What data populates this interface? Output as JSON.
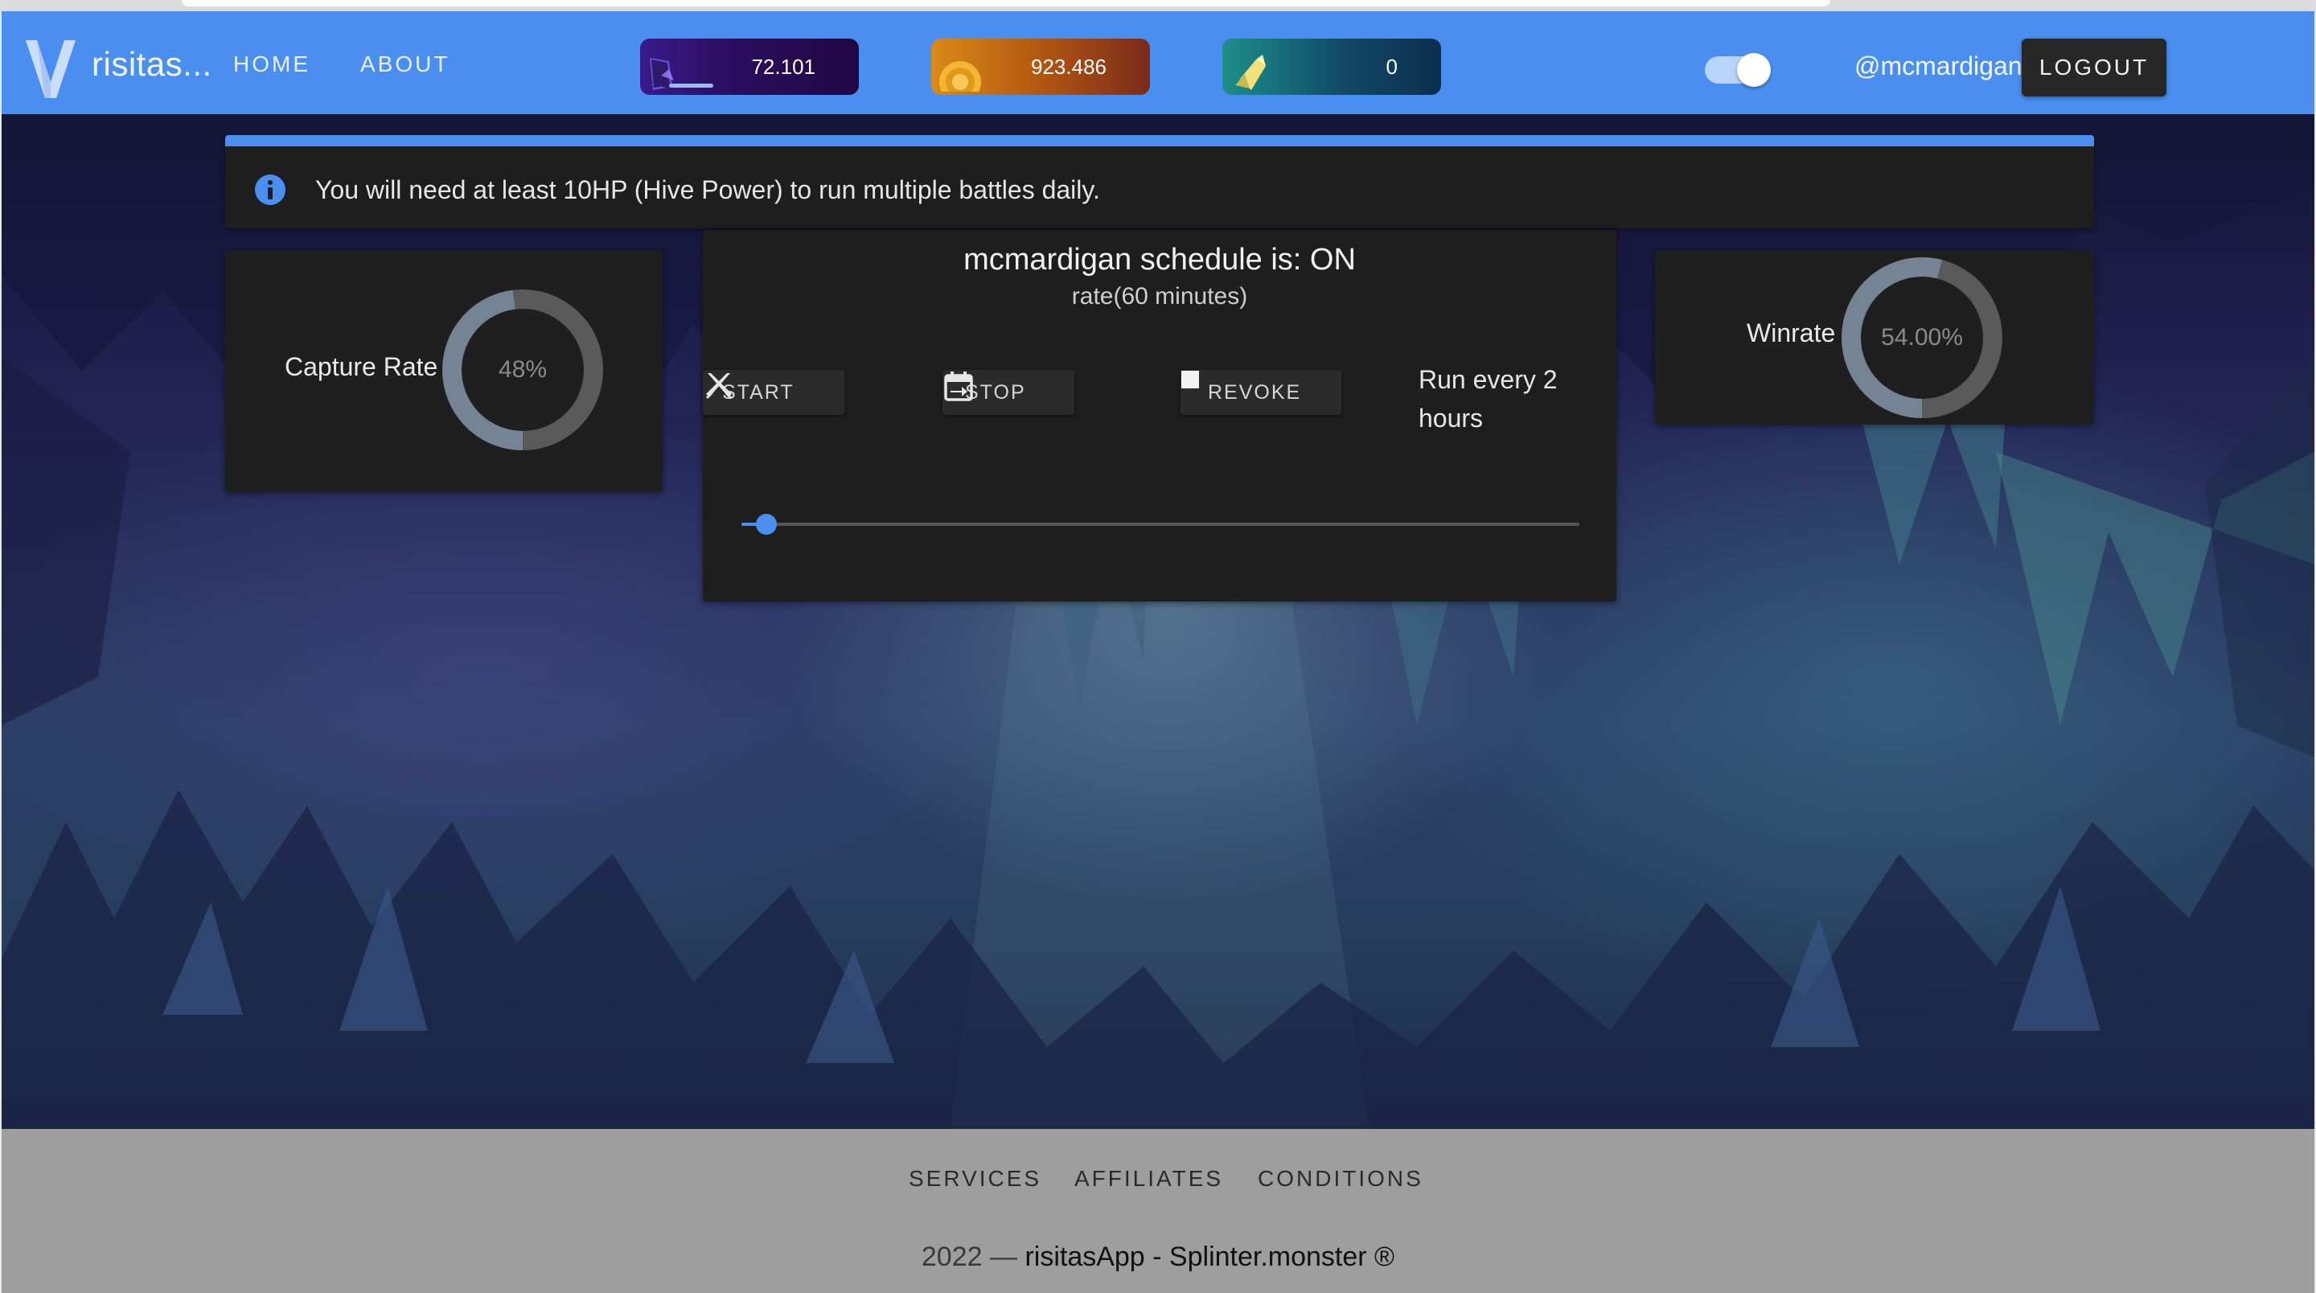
{
  "header": {
    "brand": "risitas...",
    "nav": {
      "home": "HOME",
      "about": "ABOUT"
    },
    "balances": [
      {
        "icon": "energy-card-icon",
        "value": "72.101",
        "bar_fraction": 0.5
      },
      {
        "icon": "coin-icon",
        "value": "923.486"
      },
      {
        "icon": "crystal-icon",
        "value": "0"
      }
    ],
    "theme_toggle_on": true,
    "username": "@mcmardigan",
    "logout": "LOGOUT",
    "accent_color": "#4a8ff0"
  },
  "alert": {
    "icon": "info-icon",
    "text": "You will need at least 10HP (Hive Power) to run multiple battles daily."
  },
  "capture": {
    "label": "Capture Rate",
    "value_text": "48%",
    "percent": 48
  },
  "schedule": {
    "title": "mcmardigan schedule is: ON",
    "rate": "rate(60 minutes)",
    "buttons": {
      "start": "START",
      "stop": "STOP",
      "revoke": "REVOKE"
    },
    "run_every": "Run every 2 hours",
    "slider_fraction": 0.02
  },
  "winrate": {
    "label": "Winrate",
    "value_text": "54.00%",
    "percent": 54
  },
  "footer": {
    "links": {
      "services": "SERVICES",
      "affiliates": "AFFILIATES",
      "conditions": "CONDITIONS"
    },
    "copyright_prefix": "2022 —",
    "copyright_brand": "risitasApp - Splinter.monster ®"
  }
}
